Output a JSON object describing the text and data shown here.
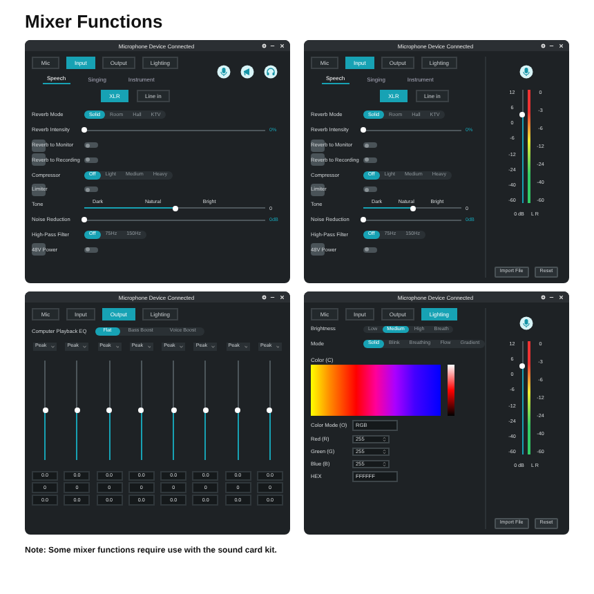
{
  "title": "Mixer Functions",
  "windows": [
    {
      "kind": "input",
      "title": "Microphone Device Connected",
      "tabs": [
        {
          "label": "Mic",
          "selected": false
        },
        {
          "label": "Input",
          "selected": true
        },
        {
          "label": "Output",
          "selected": false
        },
        {
          "label": "Lighting",
          "selected": false
        }
      ],
      "subtabs": [
        {
          "label": "Speech",
          "selected": true
        },
        {
          "label": "Singing",
          "selected": false
        },
        {
          "label": "Instrument",
          "selected": false
        }
      ],
      "sources": [
        {
          "label": "XLR",
          "selected": true
        },
        {
          "label": "Line in",
          "selected": false
        }
      ],
      "settings": [
        {
          "kind": "segmented",
          "label": "Reverb Mode",
          "options": [
            {
              "label": "Solid",
              "selected": true
            },
            {
              "label": "Room",
              "selected": false
            },
            {
              "label": "Hall",
              "selected": false
            },
            {
              "label": "KTV",
              "selected": false
            }
          ]
        },
        {
          "kind": "slider",
          "label": "Reverb Intensity",
          "level": 0,
          "reading": "0%"
        },
        {
          "kind": "toggle",
          "label": "Reverb to Monitor",
          "on": false
        },
        {
          "kind": "toggle",
          "label": "Reverb to Recording",
          "on": false
        },
        {
          "kind": "segmented",
          "label": "Compressor",
          "options": [
            {
              "label": "Off",
              "selected": true
            },
            {
              "label": "Light",
              "selected": false
            },
            {
              "label": "Medium",
              "selected": false
            },
            {
              "label": "Heavy",
              "selected": false
            }
          ]
        },
        {
          "kind": "toggle",
          "label": "Limiter",
          "on": false
        },
        {
          "kind": "tone",
          "label": "Tone",
          "marks": [
            "Dark",
            "Natural",
            "Bright"
          ],
          "level": 0.5,
          "reading": "0"
        },
        {
          "kind": "slider",
          "label": "Noise Reduction",
          "level": 0,
          "reading": "0dB"
        },
        {
          "kind": "segmented",
          "label": "High-Pass Filter",
          "options": [
            {
              "label": "Off",
              "selected": true
            },
            {
              "label": "75Hz",
              "selected": false
            },
            {
              "label": "150Hz",
              "selected": false
            }
          ]
        },
        {
          "kind": "toggle",
          "label": "48V Power",
          "on": false
        }
      ]
    },
    {
      "kind": "input",
      "title": "Microphone Device Connected",
      "tabs": [
        {
          "label": "Mic",
          "selected": false
        },
        {
          "label": "Input",
          "selected": true
        },
        {
          "label": "Output",
          "selected": false
        },
        {
          "label": "Lighting",
          "selected": false
        }
      ],
      "subtabs": [
        {
          "label": "Speech",
          "selected": true
        },
        {
          "label": "Singing",
          "selected": false
        },
        {
          "label": "Instrument",
          "selected": false
        }
      ],
      "sources": [
        {
          "label": "XLR",
          "selected": true
        },
        {
          "label": "Line in",
          "selected": false
        }
      ],
      "settings": [
        {
          "kind": "segmented",
          "label": "Reverb Mode",
          "options": [
            {
              "label": "Solid",
              "selected": true
            },
            {
              "label": "Room",
              "selected": false
            },
            {
              "label": "Hall",
              "selected": false
            },
            {
              "label": "KTV",
              "selected": false
            }
          ]
        },
        {
          "kind": "slider",
          "label": "Reverb Intensity",
          "level": 0,
          "reading": "0%"
        },
        {
          "kind": "toggle",
          "label": "Reverb to Monitor",
          "on": false
        },
        {
          "kind": "toggle",
          "label": "Reverb to Recording",
          "on": false
        },
        {
          "kind": "segmented",
          "label": "Compressor",
          "options": [
            {
              "label": "Off",
              "selected": true
            },
            {
              "label": "Light",
              "selected": false
            },
            {
              "label": "Medium",
              "selected": false
            },
            {
              "label": "Heavy",
              "selected": false
            }
          ]
        },
        {
          "kind": "toggle",
          "label": "Limiter",
          "on": false
        },
        {
          "kind": "tone",
          "label": "Tone",
          "marks": [
            "Dark",
            "Natural",
            "Bright"
          ],
          "level": 0.5,
          "reading": "0"
        },
        {
          "kind": "slider",
          "label": "Noise Reduction",
          "level": 0,
          "reading": "0dB"
        },
        {
          "kind": "segmented",
          "label": "High-Pass Filter",
          "options": [
            {
              "label": "Off",
              "selected": true
            },
            {
              "label": "75Hz",
              "selected": false
            },
            {
              "label": "150Hz",
              "selected": false
            }
          ]
        },
        {
          "kind": "toggle",
          "label": "48V Power",
          "on": false
        }
      ],
      "meter": {
        "level": 0.78,
        "left_scale": [
          "12",
          "6",
          "0",
          "-6",
          "-12",
          "-24",
          "-40",
          "-60"
        ],
        "right_scale": [
          "0",
          "-3",
          "-6",
          "-12",
          "-24",
          "-40",
          "-60"
        ],
        "reading": "0 dB",
        "channels": "L R"
      },
      "buttons": [
        "Import File",
        "Reset"
      ]
    },
    {
      "kind": "eq",
      "title": "Microphone Device Connected",
      "tabs": [
        {
          "label": "Mic",
          "selected": false
        },
        {
          "label": "Input",
          "selected": false
        },
        {
          "label": "Output",
          "selected": true
        },
        {
          "label": "Lighting",
          "selected": false
        }
      ],
      "eq_label": "Computer Playback EQ",
      "presets": [
        {
          "label": "Flat",
          "selected": true
        },
        {
          "label": "Bass Boost",
          "selected": false
        },
        {
          "label": "Voice Boost",
          "selected": false
        }
      ],
      "bands": [
        {
          "filter": "Peak",
          "level": 0.5,
          "values": [
            "0.0",
            "0",
            "0.0"
          ]
        },
        {
          "filter": "Peak",
          "level": 0.5,
          "values": [
            "0.0",
            "0",
            "0.0"
          ]
        },
        {
          "filter": "Peak",
          "level": 0.5,
          "values": [
            "0.0",
            "0",
            "0.0"
          ]
        },
        {
          "filter": "Peak",
          "level": 0.5,
          "values": [
            "0.0",
            "0",
            "0.0"
          ]
        },
        {
          "filter": "Peak",
          "level": 0.5,
          "values": [
            "0.0",
            "0",
            "0.0"
          ]
        },
        {
          "filter": "Peak",
          "level": 0.5,
          "values": [
            "0.0",
            "0",
            "0.0"
          ]
        },
        {
          "filter": "Peak",
          "level": 0.5,
          "values": [
            "0.0",
            "0",
            "0.0"
          ]
        },
        {
          "filter": "Peak",
          "level": 0.5,
          "values": [
            "0.0",
            "0",
            "0.0"
          ]
        }
      ]
    },
    {
      "kind": "lighting",
      "title": "Microphone Device Connected",
      "tabs": [
        {
          "label": "Mic",
          "selected": false
        },
        {
          "label": "Input",
          "selected": false
        },
        {
          "label": "Output",
          "selected": false
        },
        {
          "label": "Lighting",
          "selected": true
        }
      ],
      "settings": [
        {
          "kind": "segmented",
          "label": "Brightness",
          "options": [
            {
              "label": "Low",
              "selected": false
            },
            {
              "label": "Medium",
              "selected": true
            },
            {
              "label": "High",
              "selected": false
            },
            {
              "label": "Breath",
              "selected": false
            }
          ]
        },
        {
          "kind": "segmented",
          "label": "Mode",
          "options": [
            {
              "label": "Solid",
              "selected": true
            },
            {
              "label": "Blink",
              "selected": false
            },
            {
              "label": "Breathing",
              "selected": false
            },
            {
              "label": "Flow",
              "selected": false
            },
            {
              "label": "Gradient",
              "selected": false
            }
          ]
        }
      ],
      "color_label": "Color (C)",
      "fields": [
        {
          "kind": "text",
          "label": "Color Mode (O)",
          "value": "RGB"
        },
        {
          "kind": "spin",
          "label": "Red (R)",
          "value": "255"
        },
        {
          "kind": "spin",
          "label": "Green (G)",
          "value": "255"
        },
        {
          "kind": "spin",
          "label": "Blue (B)",
          "value": "255"
        },
        {
          "kind": "text",
          "label": "HEX",
          "value": "FFFFFF"
        }
      ],
      "meter": {
        "level": 0.78,
        "left_scale": [
          "12",
          "6",
          "0",
          "-6",
          "-12",
          "-24",
          "-40",
          "-60"
        ],
        "right_scale": [
          "0",
          "-3",
          "-6",
          "-12",
          "-24",
          "-40",
          "-60"
        ],
        "reading": "0 dB",
        "channels": "L R"
      },
      "buttons": [
        "Import File",
        "Reset"
      ]
    }
  ],
  "note": "Note: Some mixer functions require use with the sound card kit."
}
